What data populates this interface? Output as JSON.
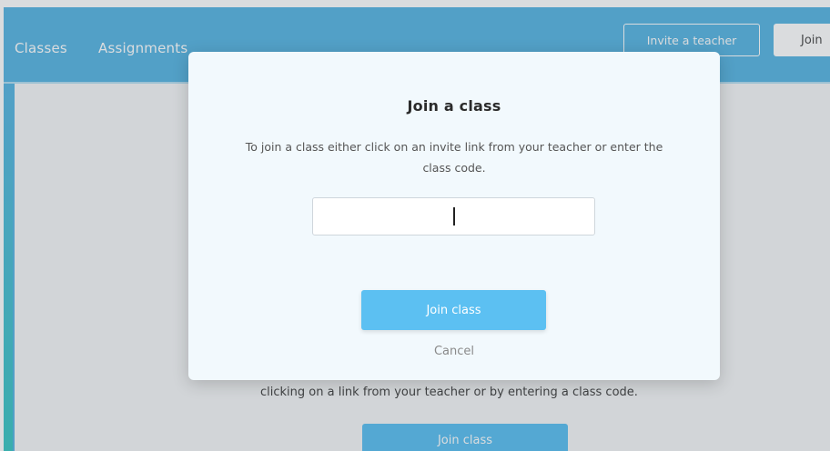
{
  "nav": {
    "classes_label": "Classes",
    "assignments_label": "Assignments",
    "invite_teacher_label": "Invite a teacher",
    "join_label": "Join"
  },
  "background": {
    "partial_text": "clicking on a link from your teacher or by entering a class code.",
    "join_button_label": "Join class"
  },
  "modal": {
    "title": "Join a class",
    "description": "To join a class either click on an invite link from your teacher or enter the class code.",
    "code_input": {
      "value": "",
      "placeholder": ""
    },
    "join_button_label": "Join class",
    "cancel_label": "Cancel"
  },
  "colors": {
    "header_blue": "#5ab6e3",
    "primary_button": "#5cc0f2",
    "modal_bg": "#f2f9fd"
  }
}
